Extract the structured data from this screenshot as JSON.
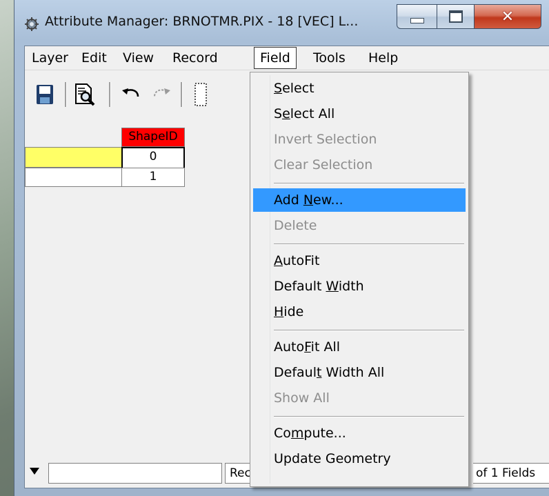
{
  "window": {
    "title": "Attribute Manager: BRNOTMR.PIX - 18 [VEC] L...",
    "icons": {
      "app": "attribute-manager-icon",
      "minimize": "minimize-icon",
      "maximize": "maximize-icon",
      "close": "close-icon"
    }
  },
  "menubar": {
    "items": [
      {
        "label": "Layer"
      },
      {
        "label": "Edit"
      },
      {
        "label": "View"
      },
      {
        "label": "Record"
      },
      {
        "label": "Field",
        "open": true
      },
      {
        "label": "Tools"
      },
      {
        "label": "Help"
      }
    ]
  },
  "toolbar": {
    "buttons": [
      {
        "icon": "save-icon"
      },
      {
        "icon": "find-icon"
      },
      {
        "icon": "undo-icon"
      },
      {
        "icon": "redo-icon"
      },
      {
        "icon": "table-icon"
      }
    ]
  },
  "table": {
    "columns": [
      {
        "label": "ShapeID",
        "header_color": "#ff0000"
      }
    ],
    "rows": [
      {
        "selected": true,
        "value": "0"
      },
      {
        "selected": false,
        "value": "1"
      }
    ],
    "selection_color": "#ffff66"
  },
  "statusbar": {
    "dropdown_icon": "down-arrow-icon",
    "record_label": "Reco",
    "fields_label": "of 1 Fields"
  },
  "field_menu": {
    "items": [
      {
        "label": "Select",
        "mnemonic": "S",
        "enabled": true
      },
      {
        "label": "Select All",
        "mnemonic": "e",
        "enabled": true
      },
      {
        "label": "Invert Selection",
        "enabled": false
      },
      {
        "label": "Clear Selection",
        "enabled": false
      },
      {
        "separator": true
      },
      {
        "label": "Add New...",
        "mnemonic": "N",
        "enabled": true,
        "highlighted": true
      },
      {
        "label": "Delete",
        "enabled": false
      },
      {
        "separator": true
      },
      {
        "label": "AutoFit",
        "mnemonic": "A",
        "enabled": true
      },
      {
        "label": "Default Width",
        "mnemonic": "W",
        "enabled": true
      },
      {
        "label": "Hide",
        "mnemonic": "H",
        "enabled": true
      },
      {
        "separator": true
      },
      {
        "label": "AutoFit All",
        "mnemonic": "F",
        "enabled": true
      },
      {
        "label": "Default Width All",
        "mnemonic": "t",
        "enabled": true
      },
      {
        "label": "Show All",
        "enabled": false
      },
      {
        "separator": true
      },
      {
        "label": "Compute...",
        "mnemonic": "m",
        "enabled": true
      },
      {
        "label": "Update Geometry",
        "enabled": true
      }
    ],
    "highlight_color": "#3399ff"
  }
}
